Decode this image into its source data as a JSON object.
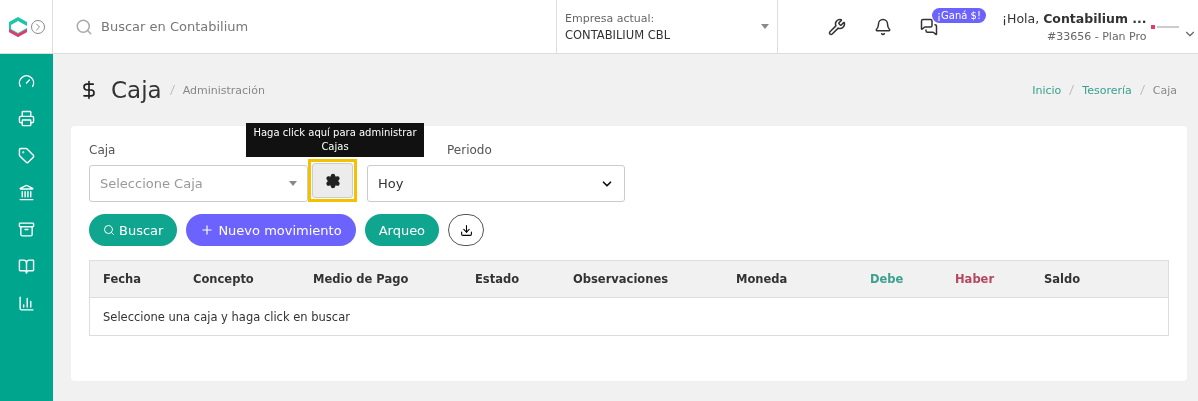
{
  "topbar": {
    "search": {
      "placeholder": "Buscar en Contabilium"
    },
    "company": {
      "label": "Empresa actual:",
      "value": "CONTABILIUM CBL"
    },
    "promo_badge": "¡Ganá $!",
    "greeting": "¡Hola, **Contabilium ...**",
    "account": "#33656 - Plan Pro"
  },
  "page": {
    "title": "Caja",
    "subtitle": "Administración",
    "breadcrumb": [
      {
        "label": "Inicio",
        "link": true
      },
      {
        "label": "Tesorería",
        "link": true
      },
      {
        "label": "Caja",
        "link": false
      }
    ]
  },
  "filters": {
    "caja": {
      "label": "Caja",
      "placeholder": "Seleccione Caja"
    },
    "tooltip": "Haga click aquí para administrar Cajas",
    "periodo": {
      "label": "Periodo",
      "value": "Hoy"
    }
  },
  "actions": [
    {
      "kind": "search",
      "label": "Buscar"
    },
    {
      "kind": "add",
      "label": "Nuevo movimiento"
    },
    {
      "kind": "plain",
      "label": "Arqueo"
    },
    {
      "kind": "download"
    }
  ],
  "table": {
    "columns": [
      {
        "label": "Fecha",
        "color": "#333333"
      },
      {
        "label": "Concepto",
        "color": "#333333"
      },
      {
        "label": "Medio de Pago",
        "color": "#333333"
      },
      {
        "label": "Estado",
        "color": "#333333"
      },
      {
        "label": "Observaciones",
        "color": "#333333"
      },
      {
        "label": "Moneda",
        "color": "#333333"
      },
      {
        "label": "Debe",
        "color": "#3aa18f"
      },
      {
        "label": "Haber",
        "color": "#b5465f"
      },
      {
        "label": "Saldo",
        "color": "#333333"
      }
    ],
    "empty_message": "Seleccione una caja y haga click en buscar"
  }
}
